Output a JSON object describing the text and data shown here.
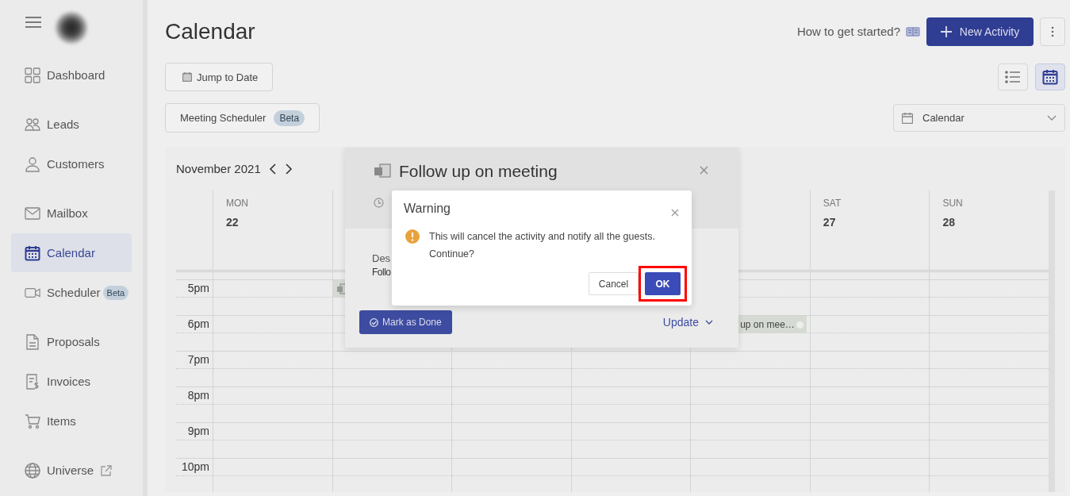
{
  "sidebar": {
    "groups": [
      {
        "items": [
          {
            "label": "Dashboard",
            "selected": false
          }
        ]
      },
      {
        "items": [
          {
            "label": "Leads",
            "selected": false
          },
          {
            "label": "Customers",
            "selected": false
          }
        ]
      },
      {
        "items": [
          {
            "label": "Mailbox",
            "selected": false
          },
          {
            "label": "Calendar",
            "selected": true
          },
          {
            "label": "Scheduler",
            "selected": false,
            "badge": "Beta"
          }
        ]
      },
      {
        "items": [
          {
            "label": "Proposals",
            "selected": false
          },
          {
            "label": "Invoices",
            "selected": false
          },
          {
            "label": "Items",
            "selected": false
          }
        ]
      },
      {
        "items": [
          {
            "label": "Universe",
            "selected": false
          }
        ]
      }
    ]
  },
  "header": {
    "title": "Calendar",
    "help_link": "How to get started?",
    "primary_button": "New Activity"
  },
  "toolbar": {
    "jump_button": "Jump to Date",
    "scheduler_button": {
      "label": "Meeting Scheduler",
      "badge": "Beta"
    },
    "views": [
      {
        "kind": "list",
        "selected": false
      },
      {
        "kind": "calendar",
        "selected": true
      }
    ],
    "view_select": {
      "value": "Calendar"
    }
  },
  "calendar": {
    "month": "November 2021",
    "days": [
      {
        "name": "MON",
        "date": "22"
      },
      {
        "name": "SAT",
        "date": "27"
      },
      {
        "name": "SUN",
        "date": "28"
      }
    ],
    "rows": [
      {
        "time": "5pm",
        "cells": [
          {},
          {
            "event": {
              "kind": "meeting"
            }
          },
          {},
          {},
          {},
          {},
          {}
        ]
      },
      {
        "time": "6pm",
        "cells": [
          {},
          {},
          {},
          {},
          {
            "event": {
              "kind": "meeting",
              "title": "up on mee…"
            }
          },
          {},
          {}
        ]
      },
      {
        "time": "7pm",
        "cells": [
          {},
          {},
          {},
          {},
          {},
          {},
          {}
        ]
      },
      {
        "time": "8pm",
        "cells": [
          {},
          {},
          {},
          {},
          {},
          {},
          {}
        ]
      },
      {
        "time": "9pm",
        "cells": [
          {},
          {},
          {},
          {},
          {},
          {},
          {}
        ]
      },
      {
        "time": "10pm",
        "cells": [
          {},
          {},
          {},
          {},
          {},
          {},
          {}
        ]
      }
    ]
  },
  "popover": {
    "title": "Follow up on meeting",
    "description_label": "Des",
    "description": "Follo",
    "done_button": "Mark as Done",
    "update_button": "Update"
  },
  "warning": {
    "title": "Warning",
    "message": "This will cancel the activity and notify all the guests. Continue?",
    "buttons": [
      {
        "label": "Cancel",
        "kind": "secondary",
        "highlighted": false
      },
      {
        "label": "OK",
        "kind": "primary",
        "highlighted": true
      }
    ]
  }
}
